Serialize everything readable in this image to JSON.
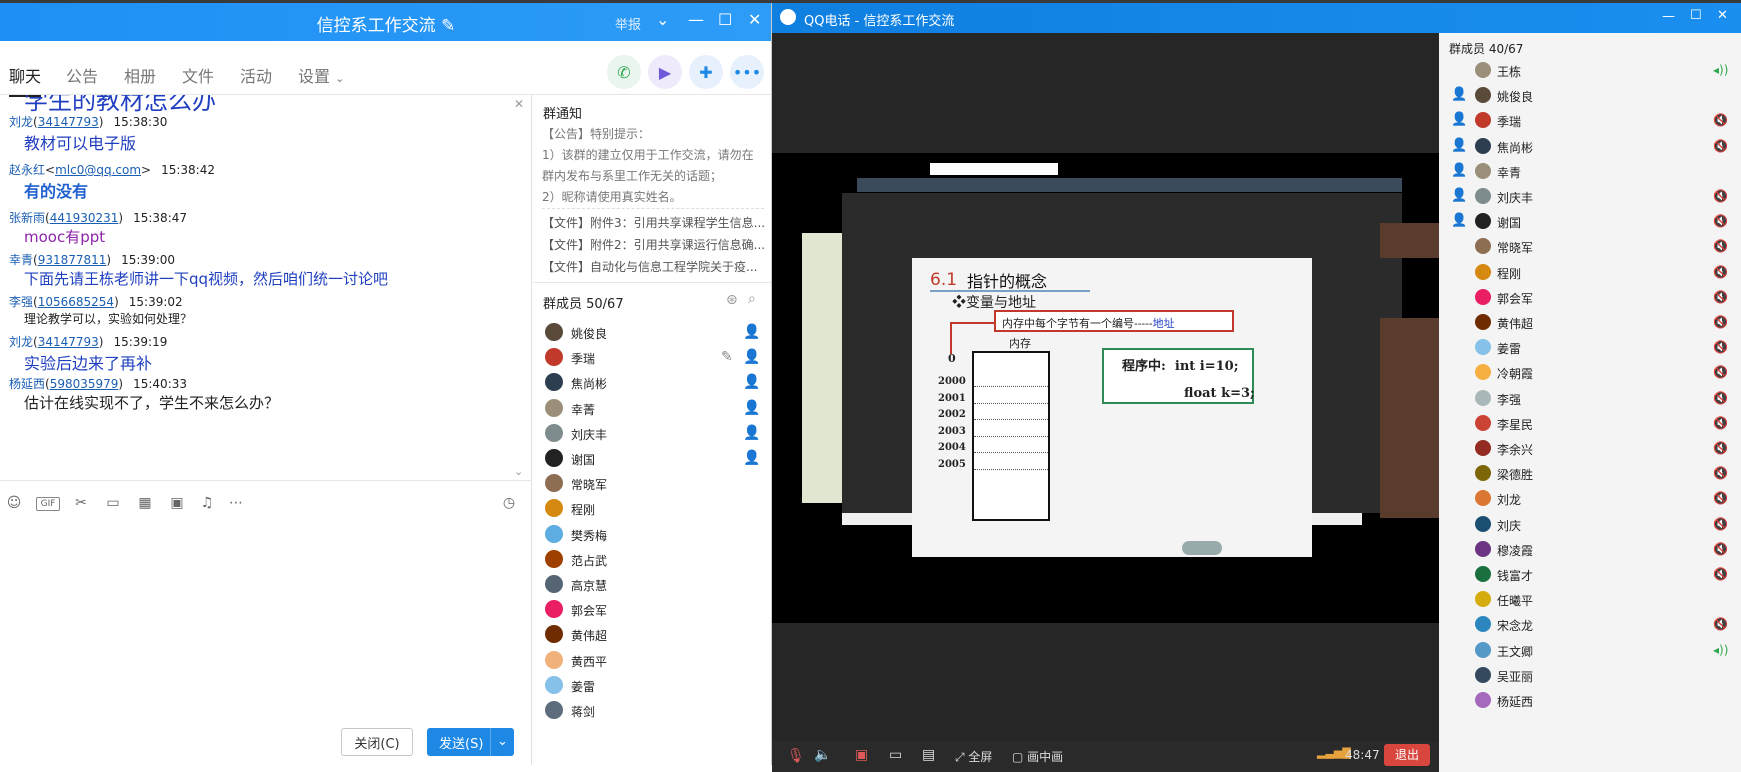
{
  "chat_window": {
    "title": "信控系工作交流",
    "report": "举报",
    "tabs": [
      "聊天",
      "公告",
      "相册",
      "文件",
      "活动",
      "设置"
    ],
    "partial_top_message": "学生的教材怎么办",
    "messages": [
      {
        "name": "刘龙",
        "qq": "34147793",
        "time": "15:38:30",
        "text": "教材可以电子版",
        "style": "large"
      },
      {
        "name": "赵永红",
        "qq": "mlc0@qq.com",
        "time": "15:38:42",
        "text": "有的没有",
        "style": "bold-blue",
        "email": true
      },
      {
        "name": "张新雨",
        "qq": "441930231",
        "time": "15:38:47",
        "text": "mooc有ppt",
        "style": "purple"
      },
      {
        "name": "幸青",
        "qq": "931877811",
        "time": "15:39:00",
        "text": "下面先请王栋老师讲一下qq视频，然后咱们统一讨论吧",
        "style": "blue"
      },
      {
        "name": "李强",
        "qq": "1056685254",
        "time": "15:39:02",
        "text": "理论教学可以，实验如何处理？",
        "style": "small"
      },
      {
        "name": "刘龙",
        "qq": "34147793",
        "time": "15:39:19",
        "text": "实验后边来了再补",
        "style": "large"
      },
      {
        "name": "杨延西",
        "qq": "598035979",
        "time": "15:40:33",
        "text": "估计在线实现不了，学生不来怎么办？",
        "style": "large-black"
      }
    ],
    "close_label": "关闭(C)",
    "send_label": "发送(S)",
    "notice": {
      "header": "群通知",
      "lines": [
        "【公告】特别提示：",
        "1）该群的建立仅用于工作交流，请勿在",
        "群内发布与系里工作无关的话题；",
        "2）昵称请使用真实姓名。"
      ],
      "files": [
        "【文件】附件3：引用共享课程学生信息...",
        "【文件】附件2：引用共享课运行信息确...",
        "【文件】自动化与信息工程学院关于疫..."
      ]
    },
    "members_header": "群成员 50/67",
    "members": [
      {
        "name": "姚俊良",
        "role": "admin",
        "color": "#5a4a3a"
      },
      {
        "name": "季瑞",
        "role": "member",
        "color": "#c0392b"
      },
      {
        "name": "焦尚彬",
        "role": "member",
        "color": "#2c3e50"
      },
      {
        "name": "幸菁",
        "role": "member",
        "color": "#9b8f7a"
      },
      {
        "name": "刘庆丰",
        "role": "member",
        "color": "#7f8c8d"
      },
      {
        "name": "谢国",
        "role": "member",
        "color": "#222"
      },
      {
        "name": "常晓军",
        "role": "",
        "color": "#8e6e53"
      },
      {
        "name": "程刚",
        "role": "",
        "color": "#d68910"
      },
      {
        "name": "樊秀梅",
        "role": "",
        "color": "#5dade2"
      },
      {
        "name": "范占武",
        "role": "",
        "color": "#a04000"
      },
      {
        "name": "高京慧",
        "role": "",
        "color": "#566573"
      },
      {
        "name": "郭会军",
        "role": "",
        "color": "#e91e63"
      },
      {
        "name": "黄伟超",
        "role": "",
        "color": "#6e2c00"
      },
      {
        "name": "黄西平",
        "role": "",
        "color": "#f0b27a"
      },
      {
        "name": "姜雷",
        "role": "",
        "color": "#85c1e9"
      },
      {
        "name": "蒋剑",
        "role": "",
        "color": "#5d6d7e"
      }
    ]
  },
  "call_window": {
    "title": "QQ电话 - 信控系工作交流",
    "members_header": "群成员 40/67",
    "participants": [
      {
        "name": "王栋",
        "host": false,
        "speaking": true,
        "color": "#9b8f7a"
      },
      {
        "name": "姚俊良",
        "host": true,
        "speaking": false,
        "color": "#5a4a3a",
        "nomute": true
      },
      {
        "name": "季瑞",
        "host": true,
        "color": "#c0392b"
      },
      {
        "name": "焦尚彬",
        "host": true,
        "color": "#2c3e50"
      },
      {
        "name": "幸青",
        "host": true,
        "color": "#9b8f7a",
        "nomute": true
      },
      {
        "name": "刘庆丰",
        "host": true,
        "color": "#7f8c8d"
      },
      {
        "name": "谢国",
        "host": true,
        "color": "#222"
      },
      {
        "name": "常晓军",
        "host": false,
        "color": "#8e6e53"
      },
      {
        "name": "程刚",
        "host": false,
        "color": "#d68910"
      },
      {
        "name": "郭会军",
        "host": false,
        "color": "#e91e63"
      },
      {
        "name": "黄伟超",
        "host": false,
        "color": "#6e2c00"
      },
      {
        "name": "姜雷",
        "host": false,
        "color": "#85c1e9"
      },
      {
        "name": "冷朝霞",
        "host": false,
        "color": "#f5b041"
      },
      {
        "name": "李强",
        "host": false,
        "color": "#aab7b8"
      },
      {
        "name": "李星民",
        "host": false,
        "color": "#cb4335"
      },
      {
        "name": "李余兴",
        "host": false,
        "color": "#922b21"
      },
      {
        "name": "梁德胜",
        "host": false,
        "color": "#7d6608"
      },
      {
        "name": "刘龙",
        "host": false,
        "color": "#dc7633"
      },
      {
        "name": "刘庆",
        "host": false,
        "color": "#1b4f72"
      },
      {
        "name": "穆凌霞",
        "host": false,
        "color": "#6c3483"
      },
      {
        "name": "钱富才",
        "host": false,
        "color": "#196f3d"
      },
      {
        "name": "任曦平",
        "host": false,
        "color": "#d4ac0d",
        "nomute": true
      },
      {
        "name": "宋念龙",
        "host": false,
        "color": "#2e86c1"
      },
      {
        "name": "王文卿",
        "host": false,
        "color": "#5499c7",
        "speaking": true
      },
      {
        "name": "吴亚丽",
        "host": false,
        "color": "#34495e",
        "nomute": true
      },
      {
        "name": "杨延西",
        "host": false,
        "color": "#a569bd",
        "nomute": true
      }
    ],
    "slide": {
      "num": "6.1",
      "title": "指针的概念",
      "subtitle": "❖变量与地址",
      "box_text": "内存中每个字节有一个编号-----",
      "box_addr": "地址",
      "mem_label": "内存",
      "zero": "0",
      "addresses": [
        "2000",
        "2001",
        "2002",
        "2003",
        "2004",
        "2005"
      ],
      "code_label": "程序中:",
      "code_line1": "int  i=10;",
      "code_line2": "float  k=3;"
    },
    "controls": {
      "fullscreen": "全屏",
      "pip": "画中画",
      "duration": "48:47",
      "exit": "退出"
    }
  }
}
